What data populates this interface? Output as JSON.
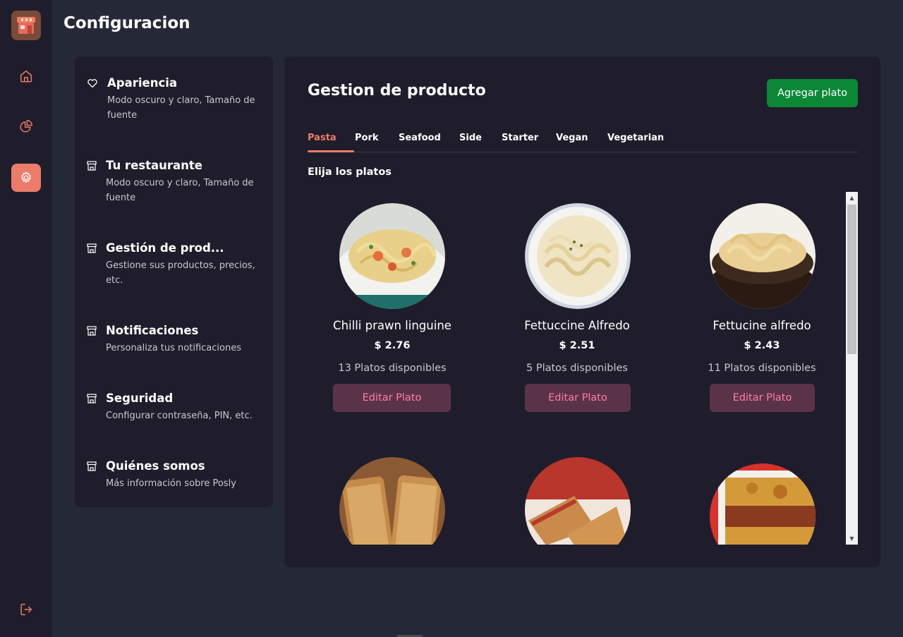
{
  "app": {
    "title": "Configuracion"
  },
  "rail": {
    "items": [
      {
        "icon": "home-icon"
      },
      {
        "icon": "pie-chart-icon"
      },
      {
        "icon": "gear-icon",
        "active": true
      }
    ],
    "logout_icon": "logout-icon"
  },
  "menu": {
    "items": [
      {
        "icon": "heart-icon",
        "title": "Apariencia",
        "desc": "Modo oscuro y claro, Tamaño de fuente"
      },
      {
        "icon": "store-icon",
        "title": "Tu restaurante",
        "desc": "Modo oscuro y claro, Tamaño de fuente"
      },
      {
        "icon": "store-icon",
        "title": "Gestión de prod...",
        "desc": "Gestione sus productos, precios, etc."
      },
      {
        "icon": "store-icon",
        "title": "Notificaciones",
        "desc": "Personaliza tus notificaciones"
      },
      {
        "icon": "store-icon",
        "title": "Seguridad",
        "desc": "Configurar contraseña, PIN, etc."
      },
      {
        "icon": "store-icon",
        "title": "Quiénes somos",
        "desc": "Más información sobre Posly"
      }
    ]
  },
  "main": {
    "title": "Gestion de producto",
    "add_label": "Agregar plato",
    "tabs": [
      {
        "label": "Pasta",
        "active": true
      },
      {
        "label": "Pork"
      },
      {
        "label": "Seafood"
      },
      {
        "label": "Side"
      },
      {
        "label": "Starter"
      },
      {
        "label": "Vegan"
      },
      {
        "label": "Vegetarian"
      }
    ],
    "section_label": "Elija los platos",
    "dishes": [
      {
        "name": "Chilli prawn linguine",
        "price": "$ 2.76",
        "available": "13 Platos disponibles",
        "edit_label": "Editar Plato"
      },
      {
        "name": "Fettuccine Alfredo",
        "price": "$ 2.51",
        "available": "5 Platos disponibles",
        "edit_label": "Editar Plato"
      },
      {
        "name": "Fettucine alfredo",
        "price": "$ 2.43",
        "available": "11 Platos disponibles",
        "edit_label": "Editar Plato"
      },
      {
        "name": "",
        "price": "",
        "available": "",
        "edit_label": ""
      },
      {
        "name": "",
        "price": "",
        "available": "",
        "edit_label": ""
      },
      {
        "name": "",
        "price": "",
        "available": "",
        "edit_label": ""
      }
    ]
  },
  "colors": {
    "accent": "#ea7c69",
    "panel": "#1f1d2b",
    "background": "#252836",
    "add_button": "#0b8736",
    "edit_button": "#5a3349",
    "edit_text": "#ff7ca3"
  }
}
